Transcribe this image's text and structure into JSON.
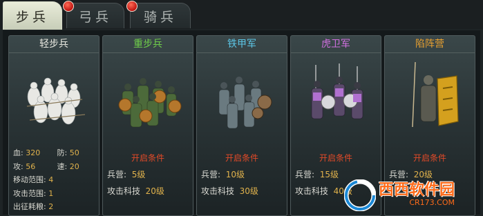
{
  "tabs": [
    {
      "label": "步兵",
      "active": true,
      "badge": false
    },
    {
      "label": "弓兵",
      "active": false,
      "badge": true
    },
    {
      "label": "骑兵",
      "active": false,
      "badge": true
    }
  ],
  "units": [
    {
      "name": "轻步兵",
      "name_color": "#e8e8e0",
      "unlocked": true,
      "stats": {
        "hp_label": "血:",
        "hp": "320",
        "def_label": "防:",
        "def": "50",
        "atk_label": "攻:",
        "atk": "56",
        "spd_label": "速:",
        "spd": "20",
        "move_label": "移动范围:",
        "move": "4",
        "range_label": "攻击范围:",
        "range": "1",
        "food_label": "出征耗粮:",
        "food": "2"
      }
    },
    {
      "name": "重步兵",
      "name_color": "#6fce4a",
      "unlocked": false,
      "unlock_title": "开启条件",
      "camp_label": "兵营:",
      "camp_level": "5级",
      "tech_label": "攻击科技",
      "tech_level": "20级"
    },
    {
      "name": "铁甲军",
      "name_color": "#5cc6e6",
      "unlocked": false,
      "unlock_title": "开启条件",
      "camp_label": "兵营:",
      "camp_level": "10级",
      "tech_label": "攻击科技",
      "tech_level": "30级"
    },
    {
      "name": "虎卫军",
      "name_color": "#d070e0",
      "unlocked": false,
      "unlock_title": "开启条件",
      "camp_label": "兵营:",
      "camp_level": "15级",
      "tech_label": "攻击科技",
      "tech_level": "40级"
    },
    {
      "name": "陷阵营",
      "name_color": "#e8a030",
      "unlocked": false,
      "unlock_title": "开启条件",
      "camp_label": "兵营:",
      "camp_level": "20级",
      "tech_label": "",
      "tech_level": ""
    }
  ],
  "watermark": {
    "name": "西西软件园",
    "url": "CR173.COM"
  }
}
